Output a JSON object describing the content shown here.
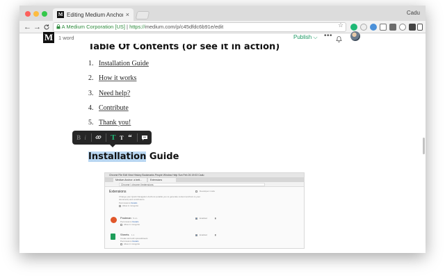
{
  "browser": {
    "tab_title": "Editing Medium Anchor, a mu",
    "tab_close": "×",
    "tab_favicon": "M",
    "profile_name": "Cadu",
    "nav_back": "←",
    "nav_forward": "→",
    "nav_reload": "C",
    "address": {
      "lock": "🔒",
      "org": "A Medium Corporation [US]",
      "separator": " | ",
      "protocol": "https://",
      "rest": "medium.com/p/c45dfdc6b91e/edit"
    },
    "star": "☆",
    "extension_colors": [
      "#1fb876",
      "#e8e8e8",
      "#4a90d9",
      "#999999",
      "#6b6b6b",
      "#888888",
      "#444444",
      "#555555",
      "#666666"
    ]
  },
  "editor": {
    "logo": "M",
    "word_count": "1 word",
    "publish_label": "Publish ⌵",
    "more_label": "•••",
    "heading": "Table Of Contents (or see it in action)",
    "toc": [
      {
        "num": "1.",
        "label": "Installation Guide"
      },
      {
        "num": "2.",
        "label": "How it works"
      },
      {
        "num": "3.",
        "label": "Need help?"
      },
      {
        "num": "4.",
        "label": "Contribute"
      },
      {
        "num": "5.",
        "label": "Thank you!"
      }
    ],
    "format_toolbar": {
      "bold": "B",
      "italic": "i",
      "link": "🔗",
      "title_large": "T",
      "title_small": "T",
      "quote": "“"
    },
    "selected_heading": {
      "highlighted": "Installation",
      "rest": " Guide"
    }
  },
  "embedded_screenshot": {
    "menubar": " Chrome   File   Edit   View   History   Bookmarks   People   Window   Help                                                                          Sun Feb 26  19:03   Cadu",
    "tab1": "Medium Anchor: a bett...",
    "tab2": "Extensions",
    "address": "Chrome | chrome://extensions",
    "page_title": "Extensions",
    "dev_mode": "Developer mode",
    "items": [
      {
        "name": "",
        "desc": "Change your Quick Navigation Anchors (enable you to generate content anchors to your",
        "desc2": "document) and contributors.",
        "perm": "Permissions",
        "details": "Details",
        "incognito": "Allow in incognito"
      },
      {
        "name": "Postman",
        "version": "5.1.1",
        "perm": "Permissions",
        "details": "Details",
        "incognito": "Allow in incognito",
        "enabled": "Enabled"
      },
      {
        "name": "Sheets",
        "version": "1.1",
        "desc": "Create and edit spreadsheets",
        "perm": "Permissions",
        "details": "Details",
        "incognito": "Allow in incognito",
        "enabled": "Enabled"
      }
    ]
  }
}
